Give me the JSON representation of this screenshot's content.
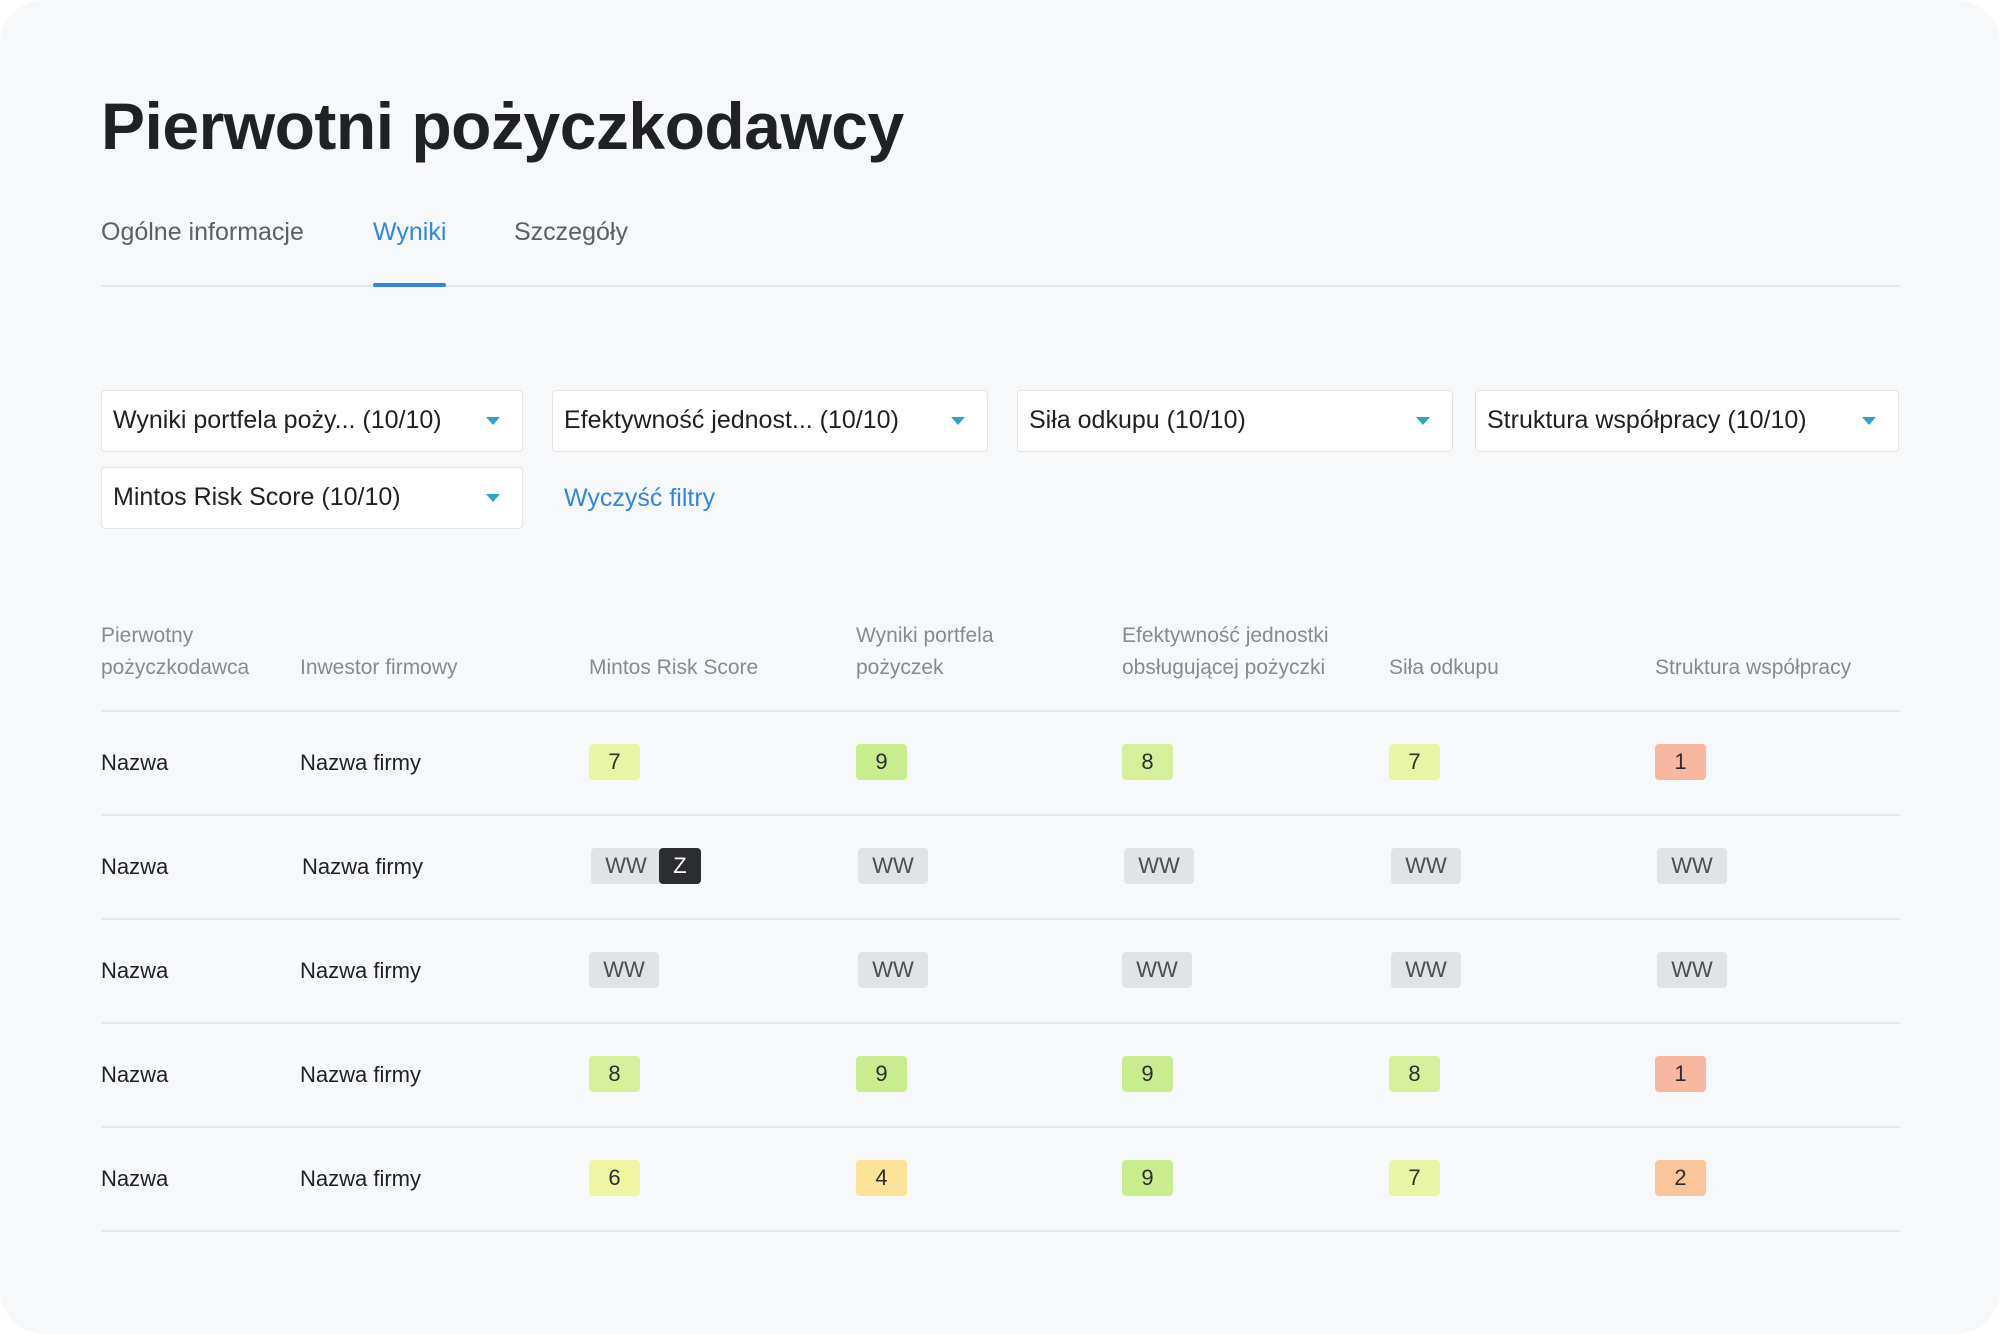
{
  "page": {
    "title": "Pierwotni pożyczkodawcy"
  },
  "tabs": [
    {
      "label": "Ogólne informacje",
      "active": false
    },
    {
      "label": "Wyniki",
      "active": true
    },
    {
      "label": "Szczegóły",
      "active": false
    }
  ],
  "filters": [
    {
      "label": "Wyniki portfela poży... (10/10)"
    },
    {
      "label": "Efektywność jednost... (10/10)"
    },
    {
      "label": "Siła odkupu (10/10)"
    },
    {
      "label": "Struktura współpracy (10/10)"
    },
    {
      "label": "Mintos Risk Score (10/10)"
    }
  ],
  "clear_filters_label": "Wyczyść filtry",
  "table": {
    "headers": [
      {
        "line1": "Pierwotny",
        "line2": "pożyczkodawca"
      },
      {
        "line1": "",
        "line2": "Inwestor firmowy"
      },
      {
        "line1": "",
        "line2": "Mintos Risk Score"
      },
      {
        "line1": "Wyniki portfela",
        "line2": "pożyczek"
      },
      {
        "line1": "Efektywność jednostki",
        "line2": "obsługującej pożyczki"
      },
      {
        "line1": "",
        "line2": "Siła odkupu"
      },
      {
        "line1": "",
        "line2": "Struktura współpracy"
      }
    ],
    "rows": [
      {
        "name": "Nazwa",
        "company": "Nazwa firmy",
        "scores": [
          "7",
          "9",
          "8",
          "7",
          "1"
        ],
        "extra": ""
      },
      {
        "name": "Nazwa",
        "company": "Nazwa firmy",
        "scores": [
          "WW",
          "WW",
          "WW",
          "WW",
          "WW"
        ],
        "extra": "Z"
      },
      {
        "name": "Nazwa",
        "company": "Nazwa firmy",
        "scores": [
          "WW",
          "WW",
          "WW",
          "WW",
          "WW"
        ],
        "extra": ""
      },
      {
        "name": "Nazwa",
        "company": "Nazwa firmy",
        "scores": [
          "8",
          "9",
          "9",
          "8",
          "1"
        ],
        "extra": ""
      },
      {
        "name": "Nazwa",
        "company": "Nazwa firmy",
        "scores": [
          "6",
          "4",
          "9",
          "7",
          "2"
        ],
        "extra": ""
      }
    ]
  },
  "colors": {
    "accent_blue": "#2f86e8",
    "caret_teal": "#2aa6bf",
    "score_9": "#c9ec8e",
    "score_8": "#d6f09a",
    "score_7": "#e8f5a3",
    "score_6": "#eef6a2",
    "score_4": "#fbe39a",
    "score_2": "#fbc59a",
    "score_1": "#f8b8a0",
    "ww_gray": "#e1e3e6",
    "z_dark": "#2b2d31"
  }
}
